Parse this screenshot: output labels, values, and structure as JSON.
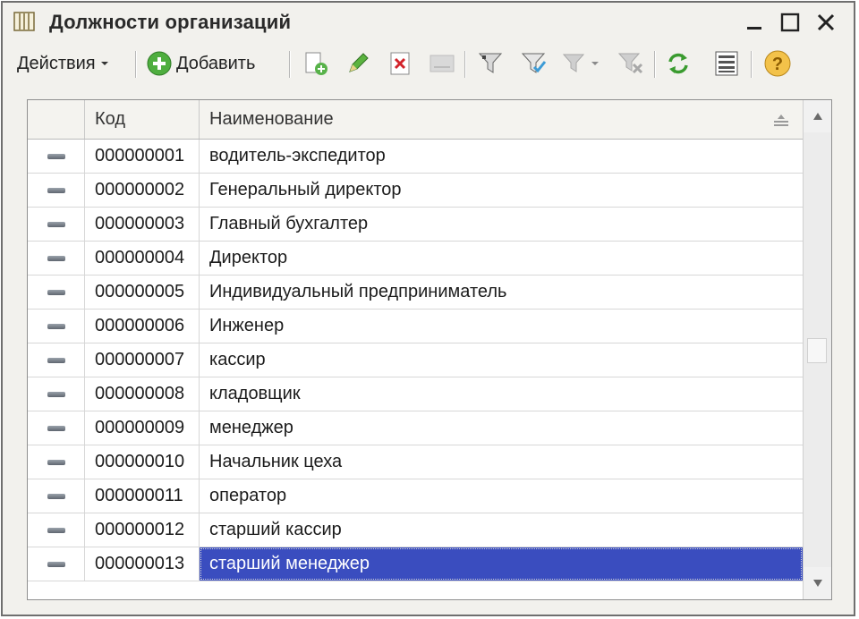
{
  "window": {
    "title": "Должности организаций",
    "minimize_icon": "minimize-icon",
    "maximize_icon": "maximize-icon",
    "close_icon": "close-icon"
  },
  "toolbar": {
    "actions_label": "Действия",
    "add_label": "Добавить"
  },
  "table": {
    "columns": [
      "",
      "Код",
      "Наименование"
    ],
    "rows": [
      {
        "code": "000000001",
        "name": "водитель-экспедитор"
      },
      {
        "code": "000000002",
        "name": "Генеральный директор"
      },
      {
        "code": "000000003",
        "name": "Главный бухгалтер"
      },
      {
        "code": "000000004",
        "name": "Директор"
      },
      {
        "code": "000000005",
        "name": "Индивидуальный предприниматель"
      },
      {
        "code": "000000006",
        "name": "Инженер"
      },
      {
        "code": "000000007",
        "name": "кассир"
      },
      {
        "code": "000000008",
        "name": "кладовщик"
      },
      {
        "code": "000000009",
        "name": "менеджер"
      },
      {
        "code": "000000010",
        "name": "Начальник цеха"
      },
      {
        "code": "000000011",
        "name": "оператор"
      },
      {
        "code": "000000012",
        "name": "старший кассир"
      },
      {
        "code": "000000013",
        "name": "старший менеджер"
      }
    ],
    "selected_row_index": 12
  },
  "colors": {
    "selection": "#3a4dbf",
    "window_bg": "#f2f1ed"
  }
}
